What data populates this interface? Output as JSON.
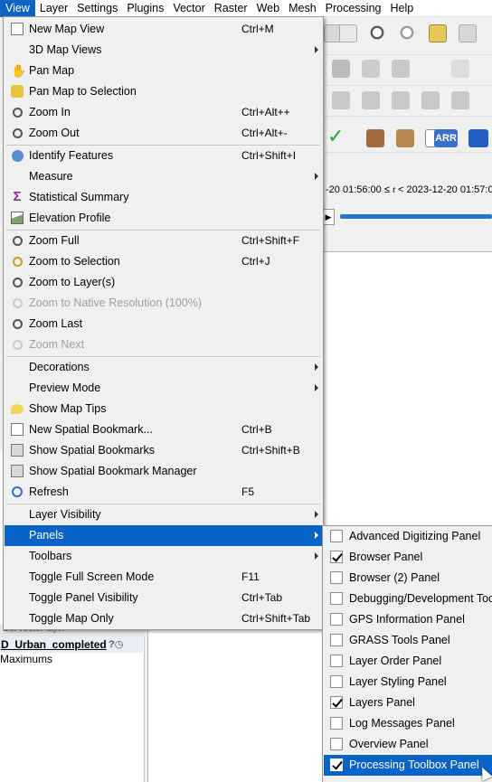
{
  "menubar": {
    "items": [
      "View",
      "Layer",
      "Settings",
      "Plugins",
      "Vector",
      "Raster",
      "Web",
      "Mesh",
      "Processing",
      "Help"
    ],
    "active": "View"
  },
  "view_menu": {
    "items": [
      {
        "label": "New Map View",
        "shortcut": "Ctrl+M",
        "icon": "new-map-view-icon"
      },
      {
        "label": "3D Map Views",
        "submenu": true
      },
      {
        "label": "Pan Map",
        "icon": "pan-hand-icon"
      },
      {
        "label": "Pan Map to Selection",
        "icon": "pan-to-selection-icon"
      },
      {
        "label": "Zoom In",
        "shortcut": "Ctrl+Alt++",
        "icon": "zoom-in-icon"
      },
      {
        "label": "Zoom Out",
        "shortcut": "Ctrl+Alt+-",
        "icon": "zoom-out-icon"
      },
      {
        "label": "Identify Features",
        "shortcut": "Ctrl+Shift+I",
        "icon": "identify-icon"
      },
      {
        "label": "Measure",
        "submenu": true
      },
      {
        "label": "Statistical Summary",
        "icon": "sigma-icon"
      },
      {
        "label": "Elevation Profile",
        "icon": "elevation-profile-icon"
      },
      {
        "label": "Zoom Full",
        "shortcut": "Ctrl+Shift+F",
        "icon": "zoom-full-icon"
      },
      {
        "label": "Zoom to Selection",
        "shortcut": "Ctrl+J",
        "icon": "zoom-selection-icon"
      },
      {
        "label": "Zoom to Layer(s)",
        "icon": "zoom-layer-icon"
      },
      {
        "label": "Zoom to Native Resolution (100%)",
        "disabled": true,
        "icon": "zoom-native-icon"
      },
      {
        "label": "Zoom Last",
        "icon": "zoom-last-icon"
      },
      {
        "label": "Zoom Next",
        "disabled": true,
        "icon": "zoom-next-icon"
      },
      {
        "label": "Decorations",
        "submenu": true
      },
      {
        "label": "Preview Mode",
        "submenu": true
      },
      {
        "label": "Show Map Tips",
        "icon": "map-tips-icon"
      },
      {
        "label": "New Spatial Bookmark...",
        "shortcut": "Ctrl+B",
        "icon": "new-bookmark-icon"
      },
      {
        "label": "Show Spatial Bookmarks",
        "shortcut": "Ctrl+Shift+B",
        "icon": "show-bookmarks-icon"
      },
      {
        "label": "Show Spatial Bookmark Manager",
        "icon": "bookmark-manager-icon"
      },
      {
        "label": "Refresh",
        "shortcut": "F5",
        "icon": "refresh-icon"
      },
      {
        "label": "Layer Visibility",
        "submenu": true
      },
      {
        "label": "Panels",
        "submenu": true,
        "highlighted": true
      },
      {
        "label": "Toolbars",
        "submenu": true
      },
      {
        "label": "Toggle Full Screen Mode",
        "shortcut": "F11"
      },
      {
        "label": "Toggle Panel Visibility",
        "shortcut": "Ctrl+Tab"
      },
      {
        "label": "Toggle Map Only",
        "shortcut": "Ctrl+Shift+Tab"
      }
    ]
  },
  "panels_submenu": {
    "items": [
      {
        "label": "Advanced Digitizing Panel",
        "checked": false
      },
      {
        "label": "Browser Panel",
        "checked": true
      },
      {
        "label": "Browser (2) Panel",
        "checked": false
      },
      {
        "label": "Debugging/Development Tool",
        "checked": false
      },
      {
        "label": "GPS Information Panel",
        "checked": false
      },
      {
        "label": "GRASS Tools Panel",
        "checked": false
      },
      {
        "label": "Layer Order Panel",
        "checked": false
      },
      {
        "label": "Layer Styling Panel",
        "checked": false
      },
      {
        "label": "Layers Panel",
        "checked": true
      },
      {
        "label": "Log Messages Panel",
        "checked": false
      },
      {
        "label": "Overview Panel",
        "checked": false
      },
      {
        "label": "Processing Toolbox Panel",
        "checked": true,
        "highlighted": true
      }
    ]
  },
  "background": {
    "time_range_prefix": "-20 01:56:00 ≤ ",
    "time_var": "t",
    "time_range_suffix": " < 2023-12-20 01:57:0",
    "layer_panel_header": "Del vector layer",
    "layer_name": "D_Urban_completed",
    "layer_sub": "Maximums",
    "toolbar_label_arr": "ARR"
  },
  "colors": {
    "accent": "#0a64c8",
    "menu_bg": "#f0f0f0",
    "disabled_text": "#a0a0a0"
  }
}
